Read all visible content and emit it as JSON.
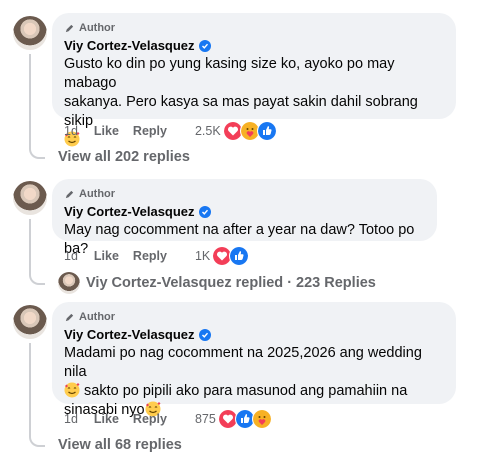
{
  "comments": [
    {
      "author_badge": "Author",
      "name": "Viy Cortez-Velasquez",
      "lines": [
        "Gusto ko din po yung kasing size ko, ayoko po may mabago",
        "sakanya. Pero kasya sa mas payat sakin dahil sobrang sikip"
      ],
      "time": "1d",
      "like": "Like",
      "reply": "Reply",
      "reactions": "2.5K",
      "view_replies": "View all 202 replies"
    },
    {
      "author_badge": "Author",
      "name": "Viy Cortez-Velasquez",
      "lines": [
        "May nag cocomment na after a year na daw? Totoo po ba?"
      ],
      "time": "1d",
      "like": "Like",
      "reply": "Reply",
      "reactions": "1K",
      "replied_text": "Viy Cortez-Velasquez replied · 223 Replies"
    },
    {
      "author_badge": "Author",
      "name": "Viy Cortez-Velasquez",
      "lines": [
        "Madami po nag cocomment na 2025,2026 ang wedding nila",
        " sakto po pipili ako para masunod ang pamahiin na",
        "sinasabi nyo"
      ],
      "time": "1d",
      "like": "Like",
      "reply": "Reply",
      "reactions": "875",
      "view_replies": "View all 68 replies"
    }
  ],
  "icons": {
    "emoji": "smiling-face-with-hearts",
    "reaction_love": "heart-reaction",
    "reaction_care": "care-reaction",
    "reaction_like": "like-reaction",
    "colors": {
      "love": "#f33e58",
      "like": "#1877f2",
      "care": "#f7b125"
    }
  }
}
